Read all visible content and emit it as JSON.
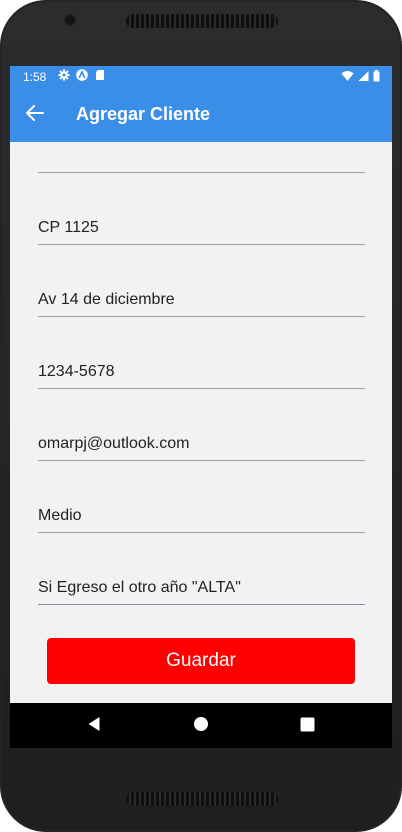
{
  "status_bar": {
    "time": "1:58",
    "left_icons": [
      "gear-icon",
      "android-studio-icon",
      "sd-card-icon"
    ],
    "right_icons": [
      "wifi-icon",
      "signal-icon",
      "battery-icon"
    ]
  },
  "app_bar": {
    "title": "Agregar Cliente",
    "back_icon": "arrow-left-icon"
  },
  "form": {
    "fields": [
      {
        "value": ""
      },
      {
        "value": "CP 1125"
      },
      {
        "value": "Av 14 de diciembre"
      },
      {
        "value": "1234-5678"
      },
      {
        "value": "omarpj@outlook.com"
      },
      {
        "value": "Medio"
      },
      {
        "value": "Si Egreso el otro año \"ALTA\""
      }
    ],
    "save_label": "Guardar"
  },
  "nav_bar": {
    "icons": [
      "back-triangle-icon",
      "home-circle-icon",
      "recents-square-icon"
    ]
  },
  "colors": {
    "app_bar": "#3a8ee8",
    "screen_bg": "#f2f2f2",
    "save_button": "#ff0000",
    "nav_bar": "#000000",
    "device_body": "#242424"
  }
}
